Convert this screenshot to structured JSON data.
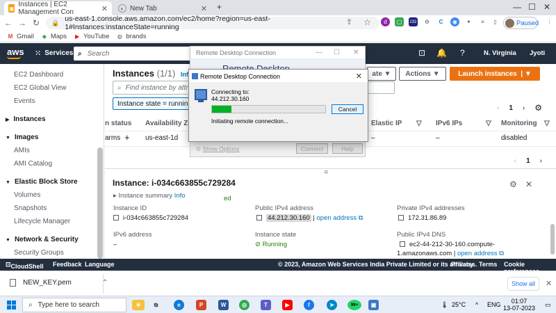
{
  "browser": {
    "tabs": [
      {
        "title": "Instances | EC2 Management Con",
        "active": true
      },
      {
        "title": "New Tab",
        "active": false
      }
    ],
    "new_tab": "+",
    "url": "us-east-1.console.aws.amazon.com/ec2/home?region=us-east-1#Instances:instanceState=running",
    "profile_label": "Paused",
    "badge": "232",
    "bookmarks": [
      "Gmail",
      "Maps",
      "YouTube",
      "brands"
    ]
  },
  "aws": {
    "logo": "aws",
    "services": "Services",
    "search_placeholder": "Search",
    "region": "N. Virginia",
    "user": "Jyoti"
  },
  "sidebar": {
    "items": [
      "EC2 Dashboard",
      "EC2 Global View",
      "Events"
    ],
    "sections": [
      {
        "label": "Instances",
        "children": []
      },
      {
        "label": "Images",
        "children": [
          "AMIs",
          "AMI Catalog"
        ]
      },
      {
        "label": "Elastic Block Store",
        "children": [
          "Volumes",
          "Snapshots",
          "Lifecycle Manager"
        ]
      },
      {
        "label": "Network & Security",
        "children": [
          "Security Groups"
        ]
      }
    ]
  },
  "main": {
    "title": "Instances",
    "count": "(1/1)",
    "info": "Info",
    "actions_btn": "Actions",
    "state_btn": "ate",
    "launch_btn": "Launch instances",
    "find_placeholder": "Find instance by attrib",
    "filter_chip": "Instance state = running",
    "page": "1",
    "columns": [
      "n status",
      "Availability Zon",
      "Elastic IP",
      "IPv6 IPs",
      "Monitoring"
    ],
    "row": {
      "status": "arms",
      "add": "+",
      "az": "us-east-1d",
      "elastic_ip": "–",
      "ipv6": "–",
      "monitoring": "disabled"
    },
    "grip": "="
  },
  "detail": {
    "title": "Instance: i-034c663855c729284",
    "summary": "Instance summary",
    "summary_info": "Info",
    "ed": "ed",
    "instance_id_label": "Instance ID",
    "instance_id": "i-034c663855c729284",
    "public_ip_label": "Public IPv4 address",
    "public_ip": "44.212.30.160",
    "open_address": "open address",
    "private_ip_label": "Private IPv4 addresses",
    "private_ip": "172.31.86.89",
    "ipv6_label": "IPv6 address",
    "ipv6": "–",
    "state_label": "Instance state",
    "state": "Running",
    "dns_label": "Public IPv4 DNS",
    "dns_line1": "ec2-44-212-30-160.compute-",
    "dns_line2": "1.amazonaws.com",
    "sep": "|"
  },
  "rdc_back": {
    "title": "Remote Desktop Connection",
    "banner": "Remote Desktop",
    "show_options": "Show Options",
    "connect": "Connect",
    "help": "Help"
  },
  "rdc": {
    "title": "Remote Desktop Connection",
    "connecting": "Connecting to:",
    "ip": "44.212.30.160",
    "status": "Initiating remote connection...",
    "cancel": "Cancel",
    "progress": 0.17
  },
  "footer": {
    "cloudshell": "CloudShell",
    "feedback": "Feedback",
    "language": "Language",
    "copyright": "© 2023, Amazon Web Services India Private Limited or its affiliates.",
    "privacy": "Privacy",
    "terms": "Terms",
    "cookies": "Cookie preferences"
  },
  "downloads": {
    "file": "NEW_KEY.pem",
    "show_all": "Show all"
  },
  "taskbar": {
    "search": "Type here to search",
    "weather": "25°C",
    "lang": "ENG",
    "time": "01:07",
    "date": "13-07-2023",
    "whatsapp_badge": "99+"
  },
  "colors": {
    "aws_nav": "#232f3e",
    "aws_orange": "#ec7211",
    "link": "#0073bb",
    "running_green": "#1d8102",
    "progress": "#06b025"
  }
}
